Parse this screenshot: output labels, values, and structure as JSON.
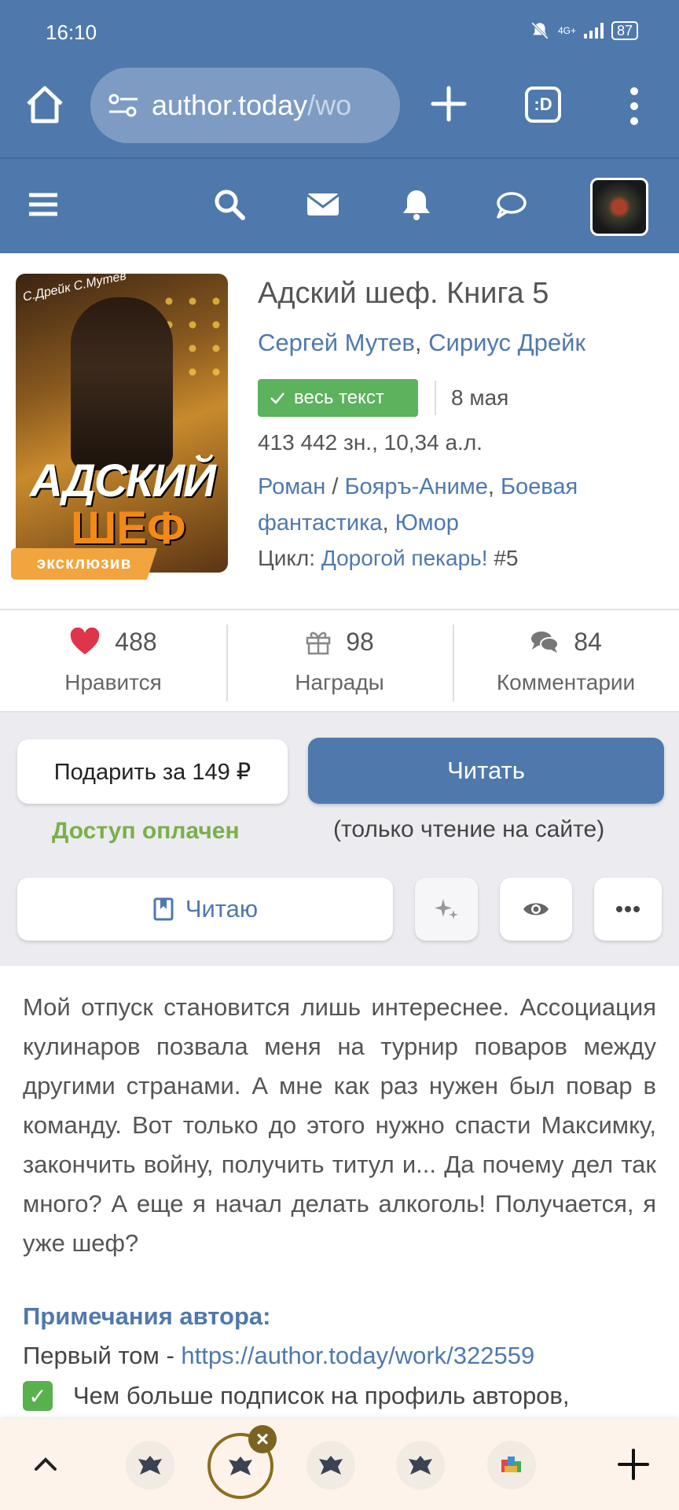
{
  "status_bar": {
    "time": "16:10",
    "network": "4G+",
    "battery": "87"
  },
  "browser": {
    "url_host": "author.today",
    "url_path": "/wo",
    "tabs_icon_label": ":D"
  },
  "book": {
    "title": "Адский шеф. Книга 5",
    "authors": [
      "Сергей Мутев",
      "Сириус Дрейк"
    ],
    "status_badge": "весь текст",
    "date": "8 мая",
    "size": "413 442 зн., 10,34 а.л.",
    "genre_main": "Роман",
    "genres": [
      "Бояръ-Аниме",
      "Боевая фантастика",
      "Юмор"
    ],
    "cycle_label": "Цикл:",
    "cycle_name": "Дорогой пекарь!",
    "cycle_num": "#5",
    "exclusive_label": "эксклюзив",
    "cover_title_line1": "АДСКИЙ",
    "cover_title_line2": "ШЕФ",
    "cover_authors": "С.Дрейк С.Мутев"
  },
  "stats": [
    {
      "icon": "heart-icon",
      "count": "488",
      "label": "Нравится"
    },
    {
      "icon": "gift-icon",
      "count": "98",
      "label": "Награды"
    },
    {
      "icon": "comments-icon",
      "count": "84",
      "label": "Комментарии"
    }
  ],
  "actions": {
    "gift_button": "Подарить за 149 ₽",
    "read_button": "Читать",
    "paid_status": "Доступ оплачен",
    "read_note": "(только чтение на сайте)",
    "reading_button": "Читаю"
  },
  "description": "Мой отпуск становится лишь интереснее. Ассоциация кулинаров позвала меня на турнир поваров между другими странами. А мне как раз нужен был повар в команду. Вот только до этого нужно спасти Максимку, закончить войну, получить титул и... Да почему дел так много? А еще я начал делать алкоголь! Получается, я уже шеф?",
  "notes": {
    "title": "Примечания автора:",
    "first_volume_label": "Первый том - ",
    "first_volume_link": "https://author.today/work/322559",
    "subscribe_line": "Чем больше подписок на профиль авторов,"
  },
  "colors": {
    "brand_blue": "#4f79ad",
    "badge_green": "#5cb25d",
    "paid_green": "#79b04a",
    "exclusive_orange": "#f2a43e",
    "like_red": "#e0344a"
  }
}
